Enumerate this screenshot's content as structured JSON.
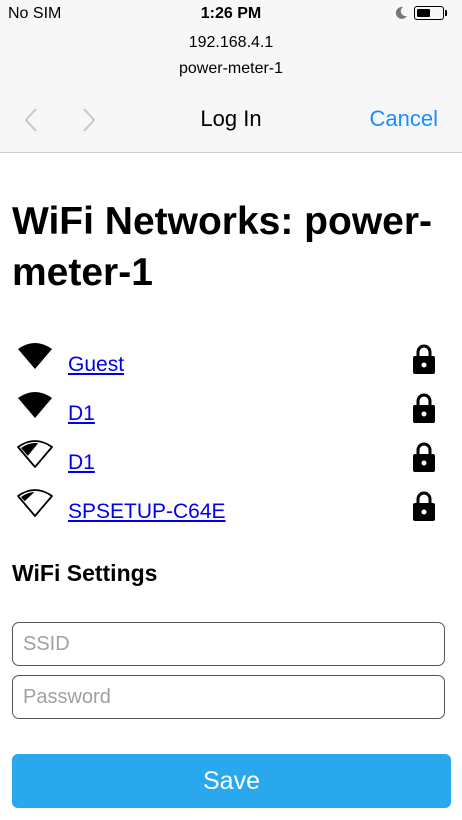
{
  "status_bar": {
    "carrier": "No SIM",
    "time": "1:26 PM",
    "battery_level_percent": 55
  },
  "browser": {
    "url_host": "192.168.4.1",
    "page_title": "power-meter-1",
    "nav_title": "Log In",
    "cancel_label": "Cancel"
  },
  "page": {
    "heading": "WiFi Networks: power-meter-1",
    "networks": [
      {
        "name": "Guest",
        "signal": "strong",
        "locked": true
      },
      {
        "name": "D1",
        "signal": "strong",
        "locked": true
      },
      {
        "name": "D1",
        "signal": "medium",
        "locked": true
      },
      {
        "name": "SPSETUP-C64E",
        "signal": "weak",
        "locked": true
      }
    ],
    "settings_heading": "WiFi Settings",
    "ssid_placeholder": "SSID",
    "ssid_value": "",
    "password_placeholder": "Password",
    "password_value": "",
    "save_label": "Save"
  },
  "colors": {
    "link": "#0000ee",
    "accent": "#1a8cff",
    "save_button": "#2aa8ee"
  }
}
